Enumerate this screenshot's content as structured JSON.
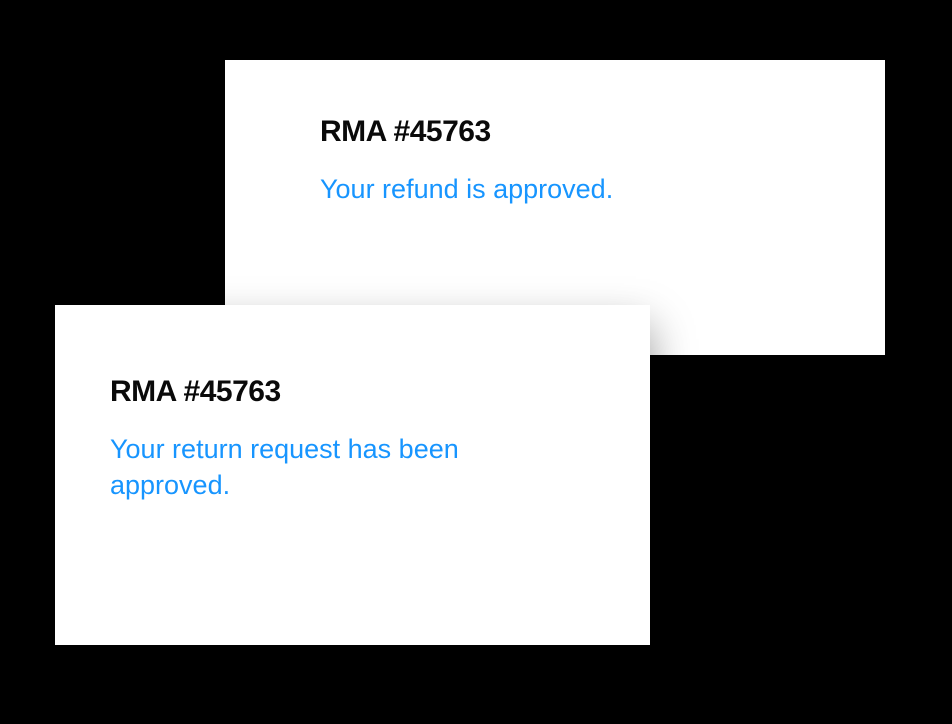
{
  "cards": {
    "back": {
      "title": "RMA #45763",
      "status": "Your refund is approved."
    },
    "front": {
      "title": "RMA #45763",
      "status": "Your return request has been approved."
    }
  }
}
